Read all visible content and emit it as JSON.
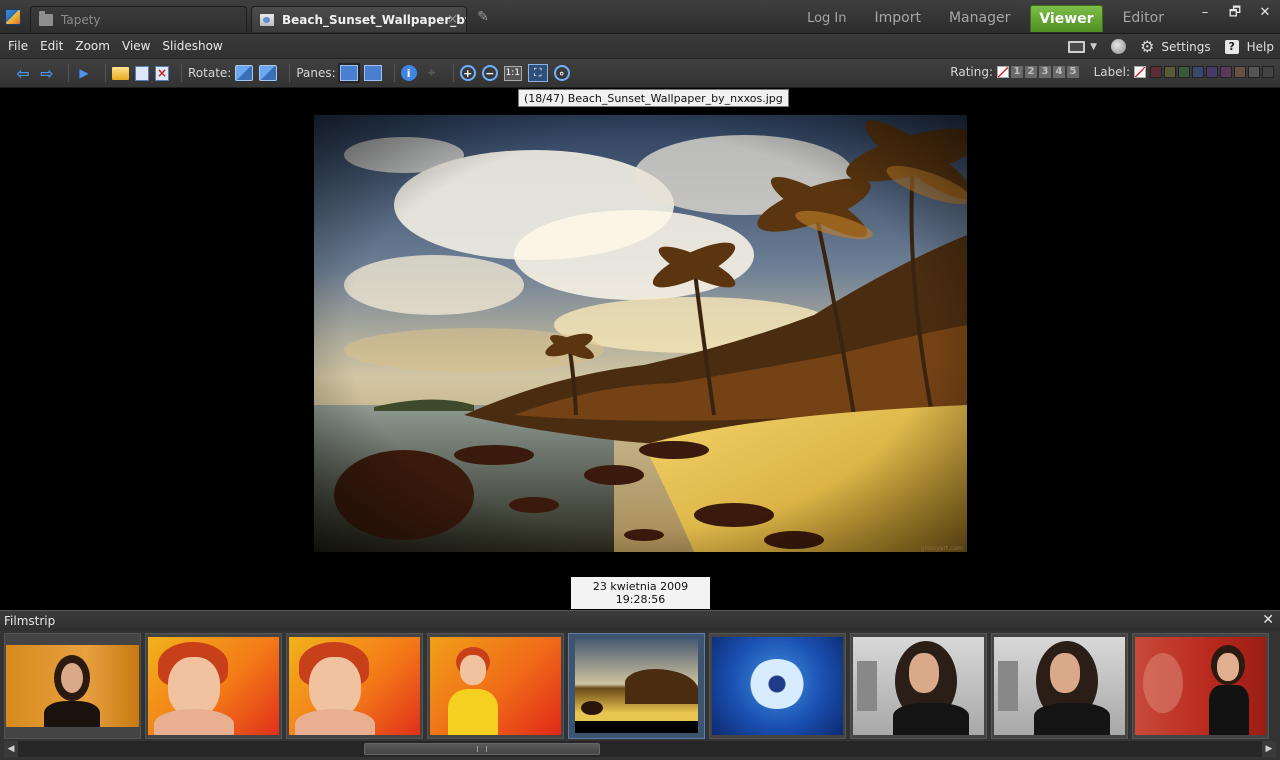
{
  "tabs": [
    {
      "label": "Tapety",
      "icon": "folder-icon",
      "active": false
    },
    {
      "label": "Beach_Sunset_Wallpaper_by_...",
      "icon": "image-file-icon",
      "active": true,
      "close": "×"
    }
  ],
  "modes": [
    {
      "label": "Log In",
      "active": false
    },
    {
      "label": "Import",
      "active": false
    },
    {
      "label": "Manager",
      "active": false
    },
    {
      "label": "Viewer",
      "active": true
    },
    {
      "label": "Editor",
      "active": false
    }
  ],
  "window_buttons": [
    "–",
    "🗗",
    "✕"
  ],
  "menu": [
    "File",
    "Edit",
    "Zoom",
    "View",
    "Slideshow"
  ],
  "menu_right": {
    "settings": "Settings",
    "help": "Help"
  },
  "toolbar": {
    "rotate_label": "Rotate:",
    "panes_label": "Panes:",
    "one_to_one": "1:1",
    "rating_label": "Rating:",
    "label_label": "Label:",
    "rating_values": [
      "1",
      "2",
      "3",
      "4",
      "5"
    ],
    "label_colors": [
      "#5a2f33",
      "#5a5a35",
      "#3a5a3a",
      "#3a4a6a",
      "#4a3a6a",
      "#5a3a5a",
      "#6a5040",
      "#555555",
      "#444444"
    ]
  },
  "viewer": {
    "file_info": "(18/47) Beach_Sunset_Wallpaper_by_nxxos.jpg",
    "date_info": "23 kwietnia 2009 19:28:56",
    "watermark": "glossyart.com"
  },
  "filmstrip": {
    "title": "Filmstrip",
    "close": "✕",
    "thumbnails": [
      {
        "subject": "woman portrait on orange background",
        "selected": false
      },
      {
        "subject": "red-haired woman on yellow red background",
        "selected": false
      },
      {
        "subject": "red-haired woman on yellow red background",
        "selected": false
      },
      {
        "subject": "red-haired woman in yellow dress",
        "selected": false
      },
      {
        "subject": "beach sunset with palm trees",
        "selected": true
      },
      {
        "subject": "blue flower on blue background",
        "selected": false
      },
      {
        "subject": "curly-haired woman city background",
        "selected": false
      },
      {
        "subject": "curly-haired woman city background",
        "selected": false
      },
      {
        "subject": "woman on red background",
        "selected": false
      }
    ]
  }
}
